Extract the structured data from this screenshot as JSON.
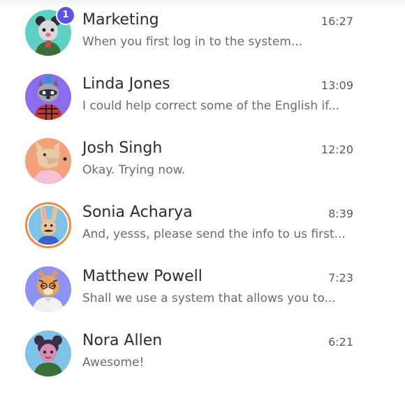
{
  "colors": {
    "badge": "#5b54e8",
    "active_ring": "#f08a3c",
    "name_text": "#2b2b33",
    "preview_text": "#6a6a74"
  },
  "chats": [
    {
      "name": "Marketing",
      "time": "16:27",
      "preview": "When you first log in to the system...",
      "unread": "1",
      "avatar_icon": "bear-avatar-icon",
      "avatar_bg": "#5fd1c4"
    },
    {
      "name": "Linda Jones",
      "time": "13:09",
      "preview": "I could help correct some of the English if...",
      "avatar_icon": "raccoon-avatar-icon",
      "avatar_bg": "#8c6df0"
    },
    {
      "name": "Josh Singh",
      "time": "12:20",
      "preview": "Okay. Trying now.",
      "avatar_icon": "fox-avatar-icon",
      "avatar_bg": "#f3a17a"
    },
    {
      "name": "Sonia Acharya",
      "time": "8:39",
      "preview": "And, yesss, please send the info to us first...",
      "avatar_icon": "rabbit-avatar-icon",
      "avatar_bg": "#7ec2e8"
    },
    {
      "name": "Matthew Powell",
      "time": "7:23",
      "preview": "Shall we use a system that allows you to...",
      "avatar_icon": "tiger-avatar-icon",
      "avatar_bg": "#8e92f2"
    },
    {
      "name": "Nora Allen",
      "time": "6:21",
      "preview": "Awesome!",
      "avatar_icon": "girl-avatar-icon",
      "avatar_bg": "#7ec2e8"
    }
  ]
}
